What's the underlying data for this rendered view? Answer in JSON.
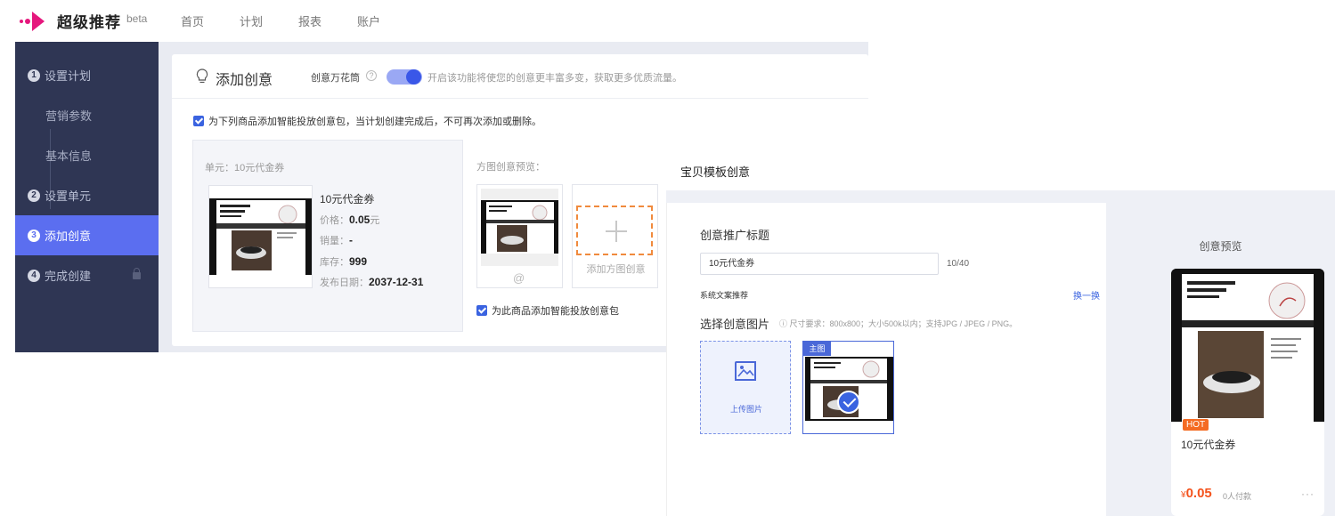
{
  "app": {
    "name": "超级推荐",
    "badge": "beta"
  },
  "nav": [
    "首页",
    "计划",
    "报表",
    "账户"
  ],
  "sidebar": {
    "items": [
      {
        "num": "1",
        "label": "设置计划"
      },
      {
        "label": "营销参数"
      },
      {
        "label": "基本信息"
      },
      {
        "num": "2",
        "label": "设置单元"
      },
      {
        "num": "3",
        "label": "添加创意"
      },
      {
        "num": "4",
        "label": "完成创建"
      }
    ]
  },
  "panel": {
    "title": "添加创意",
    "diverse_label": "创意万花筒",
    "help": "?",
    "toggle_on": true,
    "toggle_desc": "开启该功能将使您的创意更丰富多变，获取更多优质流量。",
    "notice": "为下列商品添加智能投放创意包，当计划创建完成后，不可再次添加或删除。"
  },
  "unit": {
    "label": "单元：10元代金券",
    "product_name": "10元代金券",
    "price_label": "价格：",
    "price_value": "0.05",
    "price_unit": "元",
    "sales_label": "销量：",
    "sales_value": "-",
    "stock_label": "库存：",
    "stock_value": "999",
    "date_label": "发布日期：",
    "date_value": "2037-12-31"
  },
  "square_preview": {
    "label": "方图创意预览：",
    "add_label": "添加方图创意",
    "smart_checkbox": "为此商品添加智能投放创意包"
  },
  "template": {
    "header": "宝贝模板创意",
    "title_label": "创意推广标题",
    "title_value": "10元代金券",
    "char_count": "10/40",
    "sys_rec": "系统文案推荐",
    "swap": "换一换",
    "choose_label": "选择创意图片",
    "choose_hint": "尺寸要求：800x800；大小500k以内；支持JPG / JPEG / PNG。",
    "upload_label": "上传图片",
    "main_tag": "主图"
  },
  "creative_preview": {
    "title": "创意预览",
    "hot": "HOT",
    "name": "10元代金券",
    "currency": "¥",
    "price": "0.05",
    "paid": "0人付款",
    "more": "···"
  },
  "colors": {
    "brand": "#e5177d",
    "sidebar_bg": "#2f3654",
    "active": "#5b6ef0",
    "link": "#3a63e0",
    "hot": "#f46b23",
    "price": "#f4531d"
  }
}
